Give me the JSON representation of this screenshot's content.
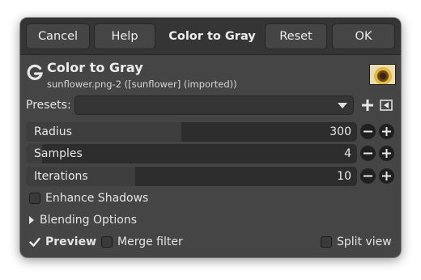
{
  "header_buttons": {
    "cancel": "Cancel",
    "help": "Help",
    "title": "Color to Gray",
    "reset": "Reset",
    "ok": "OK"
  },
  "operation": {
    "title": "Color to Gray",
    "subtitle": "sunflower.png-2 ([sunflower] (imported))",
    "logo_letter": "G"
  },
  "presets": {
    "label": "Presets:",
    "value": ""
  },
  "params": [
    {
      "label": "Radius",
      "value": "300",
      "fill_fraction": 0.47
    },
    {
      "label": "Samples",
      "value": "4",
      "fill_fraction": 0.05
    },
    {
      "label": "Iterations",
      "value": "10",
      "fill_fraction": 0.33
    }
  ],
  "options": {
    "enhance_shadows": {
      "label": "Enhance Shadows",
      "checked": false
    },
    "blending_options": "Blending Options",
    "preview": {
      "label": "Preview",
      "checked": true
    },
    "merge_filter": {
      "label": "Merge filter",
      "checked": false
    },
    "split_view": {
      "label": "Split view",
      "checked": false
    }
  },
  "colors": {
    "dialog_bg": "#454545",
    "titlebar_bg": "#353535",
    "field_bg": "#2d2d2d"
  },
  "icons": [
    "gimp-logo-icon",
    "add-preset-icon",
    "preset-menu-icon",
    "minus-icon",
    "plus-icon",
    "check-icon",
    "expander-arrow-icon"
  ]
}
